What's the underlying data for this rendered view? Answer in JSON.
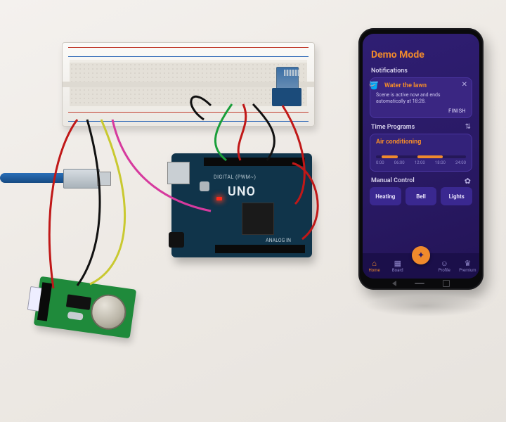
{
  "hardware": {
    "breadboard": "Solderless breadboard",
    "bt_module": "HC-05 Bluetooth",
    "mcu_name": "UNO",
    "mcu_small": "DIGITAL (PWM~)",
    "mcu_analog": "ANALOG IN",
    "rtc": "DS1302 RTC",
    "usb": "USB-B cable"
  },
  "app": {
    "title": "Demo Mode",
    "notifications": {
      "heading": "Notifications",
      "card": {
        "icon": "🪣",
        "title": "Water the lawn",
        "body": "Scene is active now and ends automatically at 18:28.",
        "action": "FINISH",
        "close": "✕"
      }
    },
    "time_programs": {
      "heading": "Time Programs",
      "icon": "⇅",
      "card_name": "Air conditioning",
      "ticks": [
        "0:00",
        "06:00",
        "12:00",
        "18:00",
        "24:00"
      ]
    },
    "manual": {
      "heading": "Manual Control",
      "icon": "✿",
      "pills": [
        "Heating",
        "Bell",
        "Lights"
      ]
    },
    "tabs": [
      {
        "icon": "⌂",
        "label": "Home",
        "active": true
      },
      {
        "icon": "▦",
        "label": "Board"
      },
      {
        "icon": "✦",
        "label": "",
        "center": true
      },
      {
        "icon": "☺",
        "label": "Profile"
      },
      {
        "icon": "♛",
        "label": "Premium"
      }
    ]
  }
}
